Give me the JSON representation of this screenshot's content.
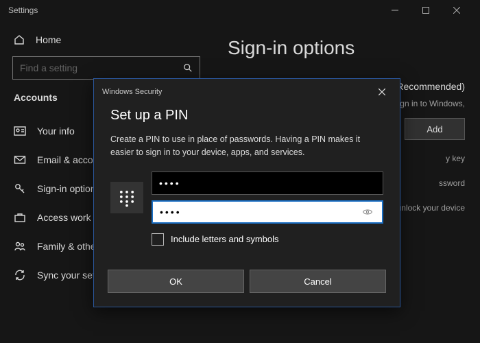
{
  "window": {
    "title": "Settings"
  },
  "sidebar": {
    "home_label": "Home",
    "search_placeholder": "Find a setting",
    "section": "Accounts",
    "items": [
      {
        "label": "Your info"
      },
      {
        "label": "Email & accounts"
      },
      {
        "label": "Sign-in options"
      },
      {
        "label": "Access work or school"
      },
      {
        "label": "Family & other users"
      },
      {
        "label": "Sync your settings"
      }
    ]
  },
  "main": {
    "heading": "Sign-in options",
    "hello_recommended": "(Recommended)",
    "hello_sub": "Sign in to Windows,",
    "add_label": "Add",
    "sec_key": "y key",
    "password": "ssword",
    "pic_pwd": "oto to unlock your device"
  },
  "modal": {
    "title": "Windows Security",
    "heading": "Set up a PIN",
    "description": "Create a PIN to use in place of passwords. Having a PIN makes it easier to sign in to your device, apps, and services.",
    "pin_value": "••••",
    "confirm_value": "••••",
    "include_label": "Include letters and symbols",
    "ok_label": "OK",
    "cancel_label": "Cancel"
  }
}
